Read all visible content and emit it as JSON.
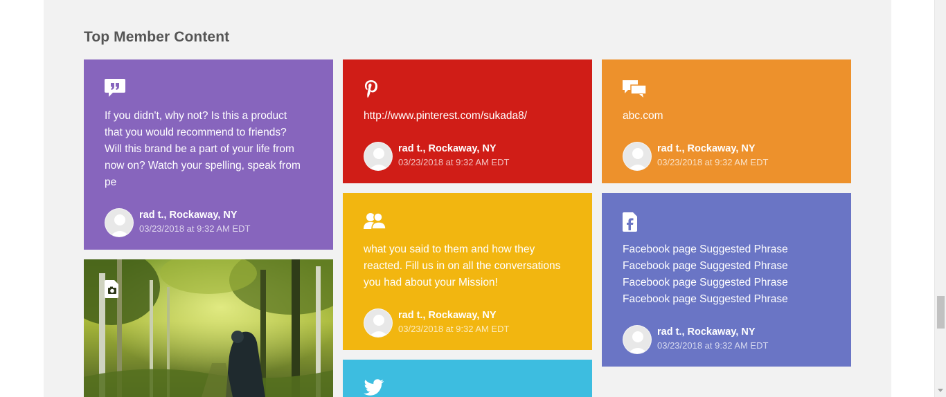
{
  "section": {
    "title": "Top Member Content"
  },
  "colors": {
    "purple": "#8765bd",
    "red": "#d01d17",
    "orange": "#ed912c",
    "yellow": "#f2b610",
    "indigo": "#6a75c5",
    "cyan": "#3dbde0",
    "panel_bg": "#f2f2f2"
  },
  "cards": [
    {
      "icon": "quote-icon",
      "lines": [
        "If you didn't, why not? Is this a product",
        "that you would recommend to friends?",
        "Will this brand be a part of your life from",
        "now on? Watch your spelling, speak from",
        "pe"
      ],
      "author": "rad t., Rockaway, NY",
      "date": "03/23/2018 at 9:32 AM EDT"
    },
    {
      "icon": "pinterest-icon",
      "lines": [
        "http://www.pinterest.com/sukada8/"
      ],
      "author": "rad t., Rockaway, NY",
      "date": "03/23/2018 at 9:32 AM EDT"
    },
    {
      "icon": "chat-bubbles-icon",
      "lines": [
        "abc.com"
      ],
      "author": "rad t., Rockaway, NY",
      "date": "03/23/2018 at 9:32 AM EDT"
    },
    {
      "icon": "users-icon",
      "lines": [
        "what you said to them and how they",
        "reacted. Fill us in on all the conversations",
        "you had about your Mission!"
      ],
      "author": "rad t., Rockaway, NY",
      "date": "03/23/2018 at 9:32 AM EDT"
    },
    {
      "icon": "facebook-icon",
      "lines": [
        "Facebook page Suggested Phrase",
        "Facebook page Suggested Phrase",
        "Facebook page Suggested Phrase",
        "Facebook page Suggested Phrase"
      ],
      "author": "rad t., Rockaway, NY",
      "date": "03/23/2018 at 9:32 AM EDT"
    }
  ],
  "photo_card": {
    "icon": "photo-file-icon"
  },
  "twitter_card": {
    "icon": "twitter-icon"
  }
}
